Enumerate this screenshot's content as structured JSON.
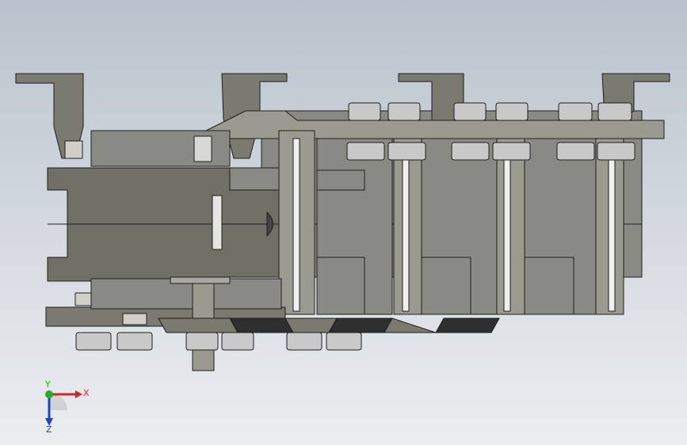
{
  "viewport": {
    "background_top": "#b9c2cc",
    "background_bottom": "#ecedef"
  },
  "colors": {
    "metal_dark": "#5c5c52",
    "metal_mid": "#7a7a70",
    "metal_light": "#9a9a90",
    "housing": "#8a8a84",
    "housing_light": "#a3a39f",
    "rubber": "#2f2f2f",
    "bolt": "#c9c9c9",
    "edge": "#1e1e1e"
  },
  "triad": {
    "x_label": "X",
    "y_label": "Y",
    "z_label": "Z",
    "x_color": "#e02020",
    "y_color": "#20b020",
    "z_color": "#2040d0"
  }
}
